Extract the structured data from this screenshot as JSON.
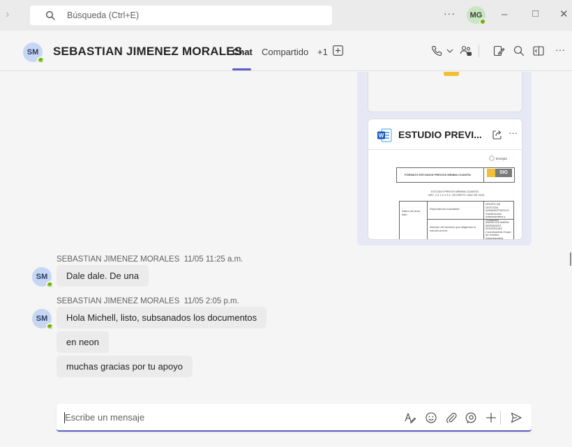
{
  "titlebar": {
    "search_placeholder": "Búsqueda (Ctrl+E)",
    "more_label": "···",
    "user_initials": "MG"
  },
  "chat_header": {
    "avatar_initials": "SM",
    "contact_name": "SEBASTIAN JIMENEZ MORALES",
    "tabs": [
      {
        "label": "Chat",
        "active": true
      },
      {
        "label": "Compartido",
        "active": false
      },
      {
        "label": "+1",
        "active": false
      }
    ],
    "more_label": "···"
  },
  "attachment": {
    "file_name": "ESTUDIO PREVI...",
    "more_label": "···",
    "preview": {
      "brand": "Energía",
      "format_title": "FORMATO ESTUDIOS PREVIOS MÍNIMA CUANTÍA",
      "sig_label": "SIG",
      "study_title": "ESTUDIO PREVIO MÍNIMA CUANTÍA",
      "article": "ART. 2.2.1.2.1.5.1. DECRETO 1082 DE 2015",
      "row_label": "Datos del área líder",
      "dependency_label": "Dependencia solicitante:",
      "dependency_value": "GRUPO DE GESTIÓN ADMINISTRATIVO Subdirección Administrativa y Financiera",
      "official_label": "Nombre del servidor que diligencia el estudio previo:",
      "official_value": "ANGELICA MARIA BERMÚDEZ RODRÍGUEZ Coordinadora Grupo de Gestión Administrativa"
    }
  },
  "messages": [
    {
      "sender": "SEBASTIAN JIMENEZ MORALES",
      "time": "11/05 11:25 a.m.",
      "initials": "SM",
      "bubbles": [
        "Dale dale. De una"
      ]
    },
    {
      "sender": "SEBASTIAN JIMENEZ MORALES",
      "time": "11/05 2:05 p.m.",
      "initials": "SM",
      "bubbles": [
        "Hola Michell, listo, subsanados los documentos",
        "en neon",
        "muchas gracias por tu apoyo"
      ]
    }
  ],
  "compose": {
    "placeholder": "Escribe un mensaje"
  },
  "colors": {
    "accent": "#5b5fc7",
    "presence_available": "#6bb700",
    "word_blue": "#185abd",
    "bubble_bg": "#ebebeb",
    "attachment_bg": "#e6e8f6"
  }
}
